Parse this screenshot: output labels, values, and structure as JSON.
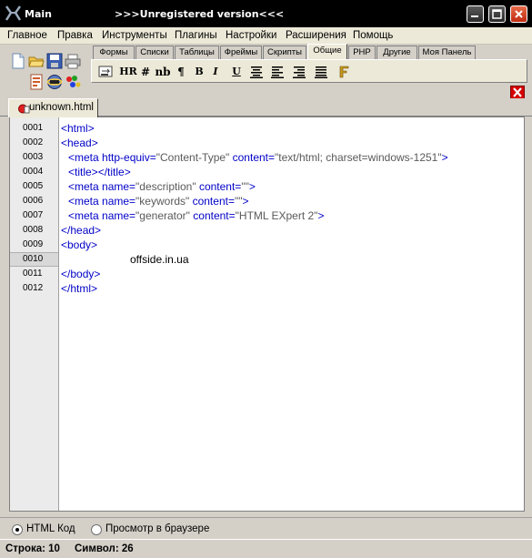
{
  "window": {
    "title": "Main",
    "subtitle": ">>>Unregistered version<<<"
  },
  "menu": [
    {
      "label": "Главное"
    },
    {
      "label": "Правка"
    },
    {
      "label": "Инструменты"
    },
    {
      "label": "Плагины"
    },
    {
      "label": "Настройки"
    },
    {
      "label": "Расширения"
    },
    {
      "label": "Помощь"
    }
  ],
  "toolbar_tabs": [
    {
      "label": "Формы"
    },
    {
      "label": "Списки"
    },
    {
      "label": "Таблицы"
    },
    {
      "label": "Фреймы"
    },
    {
      "label": "Скрипты"
    },
    {
      "label": "Общие"
    },
    {
      "label": "PHP"
    },
    {
      "label": "Другие"
    },
    {
      "label": "Моя Панель"
    }
  ],
  "active_tab": "Общие",
  "format_buttons": [
    {
      "label": "HR"
    },
    {
      "label": "#"
    },
    {
      "label": "nb"
    },
    {
      "label": "¶"
    },
    {
      "label": "B"
    },
    {
      "label": "I"
    },
    {
      "label": "U"
    }
  ],
  "document_tab": {
    "label": "unknown.html"
  },
  "editor": {
    "line_numbers": [
      "0001",
      "0002",
      "0003",
      "0004",
      "0005",
      "0006",
      "0007",
      "0008",
      "0009",
      "0010",
      "0011",
      "0012"
    ],
    "current_line": "0010",
    "lines": {
      "l1": {
        "a": "<html>"
      },
      "l2": {
        "a": "<head>"
      },
      "l3": {
        "a": "<meta http-equiv=",
        "b": "\"Content-Type\"",
        "c": " content=",
        "d": "\"text/html; charset=windows-1251\"",
        "e": ">"
      },
      "l4": {
        "a": "<title></title>"
      },
      "l5": {
        "a": "<meta name=",
        "b": "\"description\"",
        "c": " content=",
        "d": "\"\"",
        "e": ">"
      },
      "l6": {
        "a": "<meta name=",
        "b": "\"keywords\"",
        "c": " content=",
        "d": "\"\"",
        "e": ">"
      },
      "l7": {
        "a": "<meta name=",
        "b": "\"generator\"",
        "c": " content=",
        "d": "\"HTML EXpert 2\"",
        "e": ">"
      },
      "l8": {
        "a": "</head>"
      },
      "l9": {
        "a": "<body>"
      },
      "l10": {
        "a": "offside.in.ua"
      },
      "l11": {
        "a": "</body>"
      },
      "l12": {
        "a": "</html>"
      }
    }
  },
  "view_modes": [
    {
      "label": "HTML Код",
      "selected": true
    },
    {
      "label": "Просмотр в браузере",
      "selected": false
    }
  ],
  "status": {
    "line_label": "Строка: 10",
    "symbol_label": "Символ: 26"
  },
  "colors": {
    "tag": "#0000c8",
    "attribute_value": "#5a5a5a",
    "close_button": "#d40000"
  }
}
